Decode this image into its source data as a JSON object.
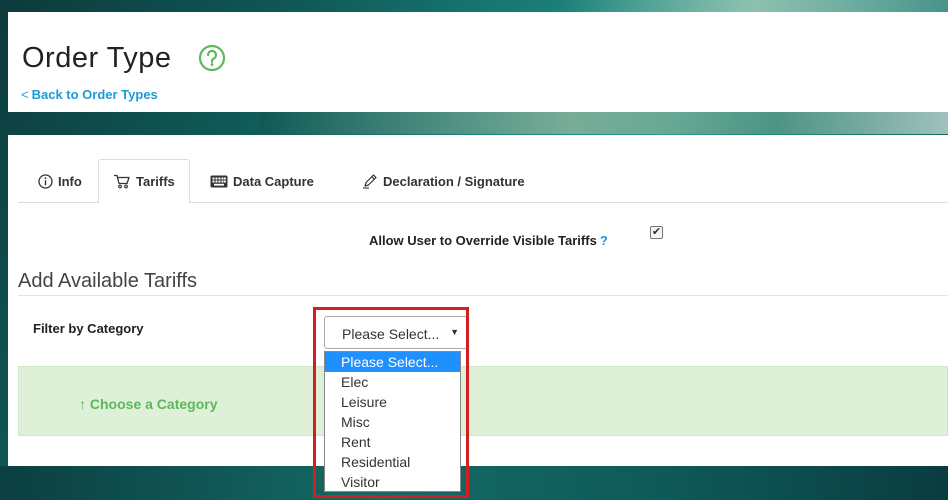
{
  "header": {
    "title": "Order Type",
    "back_link": "Back to Order Types"
  },
  "tabs": [
    {
      "label": "Info",
      "icon": "info-icon",
      "active": false
    },
    {
      "label": "Tariffs",
      "icon": "cart-icon",
      "active": true
    },
    {
      "label": "Data Capture",
      "icon": "keyboard-icon",
      "active": false
    },
    {
      "label": "Declaration / Signature",
      "icon": "pen-icon",
      "active": false
    }
  ],
  "override": {
    "label": "Allow User to Override Visible Tariffs",
    "help": "?",
    "checked": true
  },
  "section": {
    "heading": "Add Available Tariffs"
  },
  "filter": {
    "label": "Filter by Category",
    "selected": "Please Select...",
    "options": [
      "Please Select...",
      "Elec",
      "Leisure",
      "Misc",
      "Rent",
      "Residential",
      "Visitor"
    ]
  },
  "category_hint": "Choose a Category",
  "colors": {
    "accent_blue": "#1a9bd7",
    "help_green": "#5cb85c",
    "highlight_red": "#d21f1f",
    "option_selected": "#1e90ff"
  }
}
